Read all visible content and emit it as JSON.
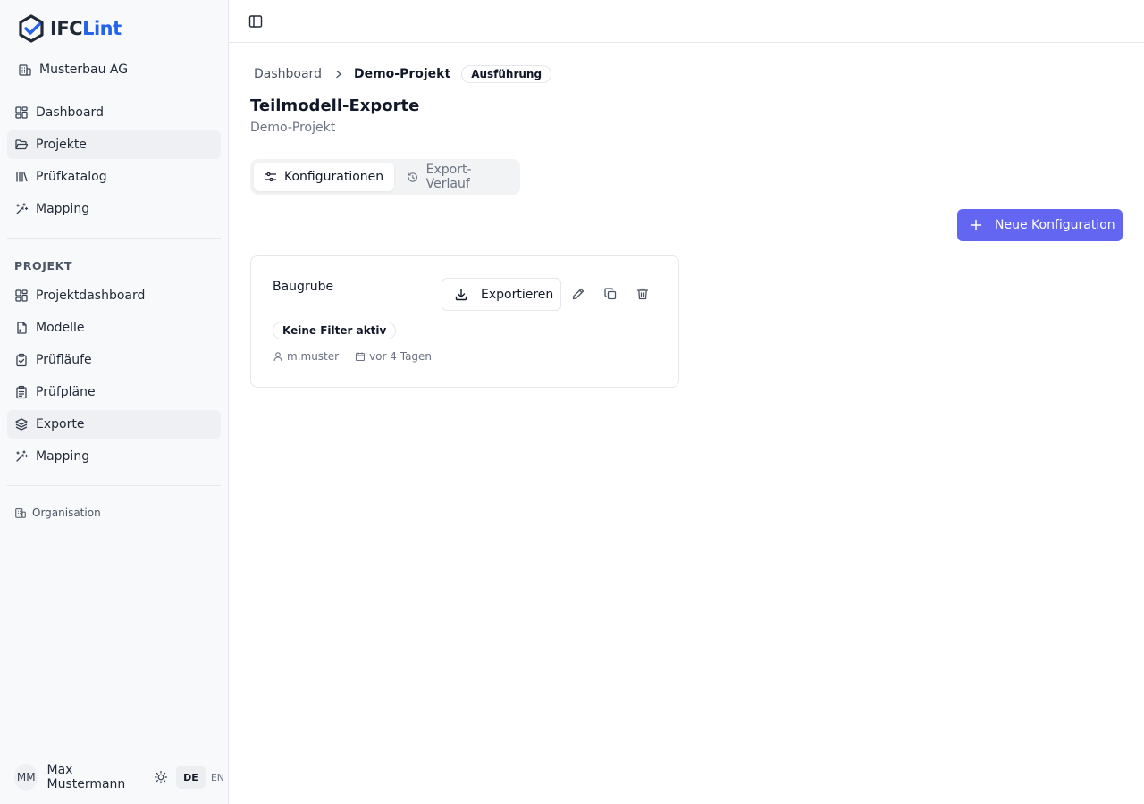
{
  "app": {
    "logo_part1": "IFC",
    "logo_part2": "Lint",
    "organization": "Musterbau AG"
  },
  "sidebar": {
    "main_items": [
      {
        "label": "Dashboard",
        "icon": "dashboard-icon"
      },
      {
        "label": "Projekte",
        "icon": "folder-open-icon"
      },
      {
        "label": "Prüfkatalog",
        "icon": "library-icon"
      },
      {
        "label": "Mapping",
        "icon": "wand-icon"
      }
    ],
    "project_section_label": "PROJEKT",
    "project_items": [
      {
        "label": "Projektdashboard",
        "icon": "dashboard-icon"
      },
      {
        "label": "Modelle",
        "icon": "file-icon"
      },
      {
        "label": "Prüfläufe",
        "icon": "clipboard-check-icon"
      },
      {
        "label": "Prüfpläne",
        "icon": "clipboard-list-icon"
      },
      {
        "label": "Exporte",
        "icon": "layers-icon"
      },
      {
        "label": "Mapping",
        "icon": "wand-icon"
      }
    ],
    "org_link": "Organisation"
  },
  "user": {
    "initials": "MM",
    "name": "Max Mustermann",
    "lang_active": "DE",
    "lang_other": "EN"
  },
  "breadcrumb": {
    "root": "Dashboard",
    "current": "Demo-Projekt",
    "badge": "Ausführung"
  },
  "page": {
    "title": "Teilmodell-Exporte",
    "subtitle": "Demo-Projekt"
  },
  "tabs": [
    {
      "label": "Konfigurationen",
      "active": true
    },
    {
      "label": "Export-Verlauf",
      "active": false
    }
  ],
  "actions": {
    "new_config": "Neue Konfiguration"
  },
  "card": {
    "title": "Baugrube",
    "export_label": "Exportieren",
    "filter_badge": "Keine Filter aktiv",
    "user": "m.muster",
    "date": "vor 4 Tagen"
  },
  "colors": {
    "accent": "#6366f1",
    "brand_blue": "#2563eb",
    "sidebar_bg": "#f8f9fb"
  }
}
